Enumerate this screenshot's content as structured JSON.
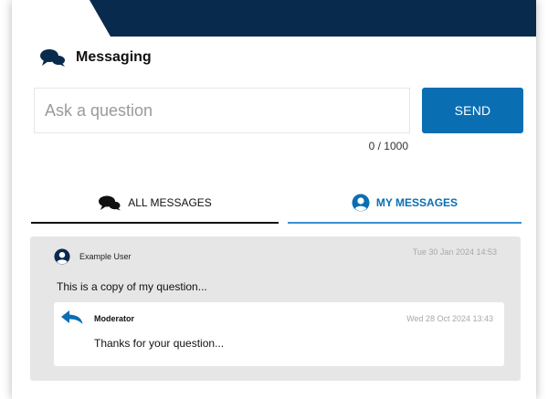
{
  "header": {
    "title": "Messaging",
    "icon": "chat-bubbles-icon"
  },
  "input": {
    "placeholder": "Ask a question",
    "value": "",
    "counter": "0 / 1000"
  },
  "send": {
    "label": "SEND"
  },
  "tabs": [
    {
      "label": "ALL MESSAGES",
      "icon": "chat-bubbles-icon",
      "active": false
    },
    {
      "label": "MY MESSAGES",
      "icon": "user-circle-icon",
      "active": true
    }
  ],
  "thread": {
    "user": "Example User",
    "time": "Tue 30 Jan 2024 14:53",
    "text": "This is a copy of my question...",
    "reply": {
      "author": "Moderator",
      "time": "Wed 28 Oct 2024 13:43",
      "text": "Thanks for your question..."
    }
  },
  "colors": {
    "banner": "#082a4d",
    "accent": "#0a6eb3",
    "thread_bg": "#e6e6e6"
  }
}
